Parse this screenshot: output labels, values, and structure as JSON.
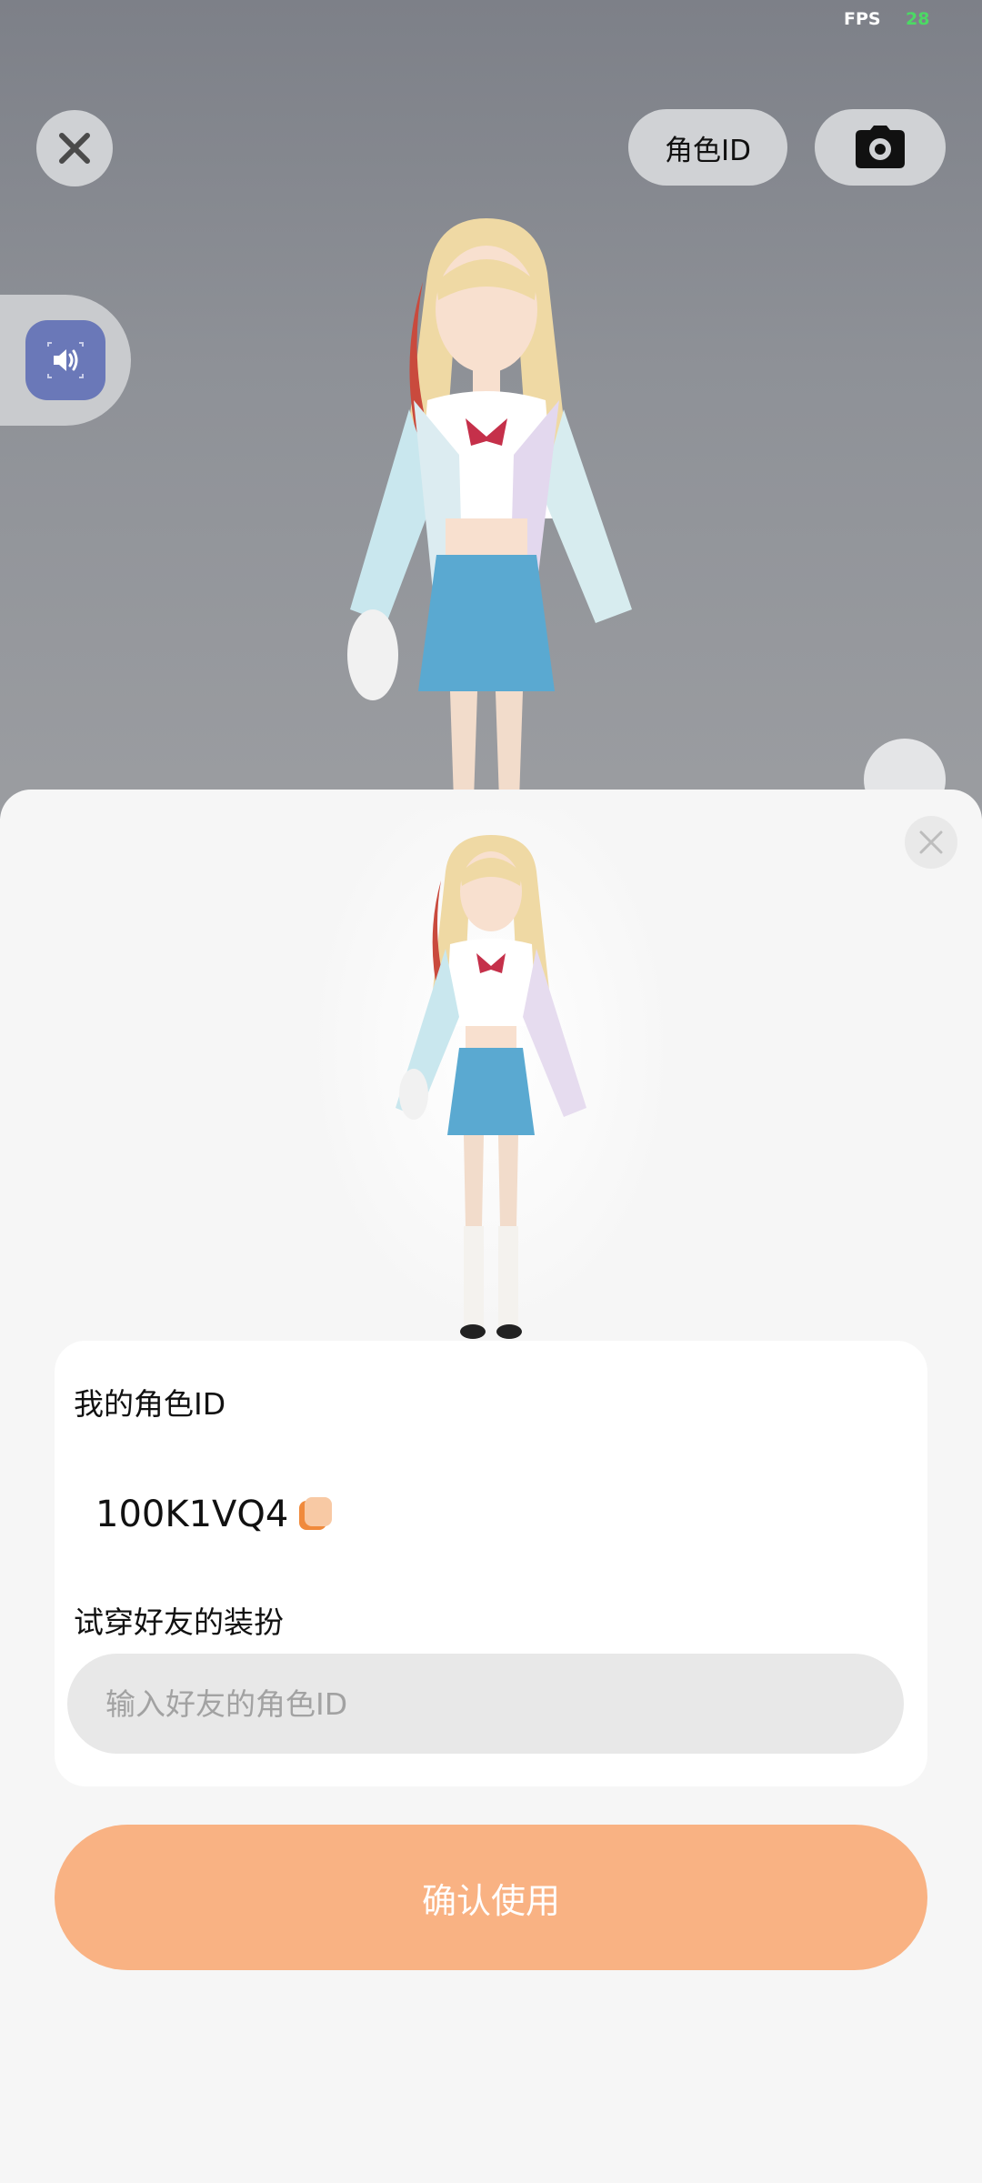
{
  "status": {
    "fps_label": "FPS",
    "fps_value": "28"
  },
  "scene": {
    "close_icon": "close-icon",
    "role_id_button": "角色ID",
    "camera_icon": "camera-icon",
    "sound_icon": "speaker-icon"
  },
  "sheet": {
    "close_icon": "close-icon",
    "my_role_id_label": "我的角色ID",
    "my_role_id_value": "100K1VQ4",
    "copy_icon": "copy-icon",
    "try_on_label": "试穿好友的装扮",
    "friend_id_placeholder": "输入好友的角色ID",
    "friend_id_value": "",
    "confirm_button": "确认使用"
  },
  "colors": {
    "accent_button": "#f9b283",
    "copy_icon": "#f08a3c",
    "sound_button": "#6a78b8",
    "fps_value": "#4cd964"
  }
}
